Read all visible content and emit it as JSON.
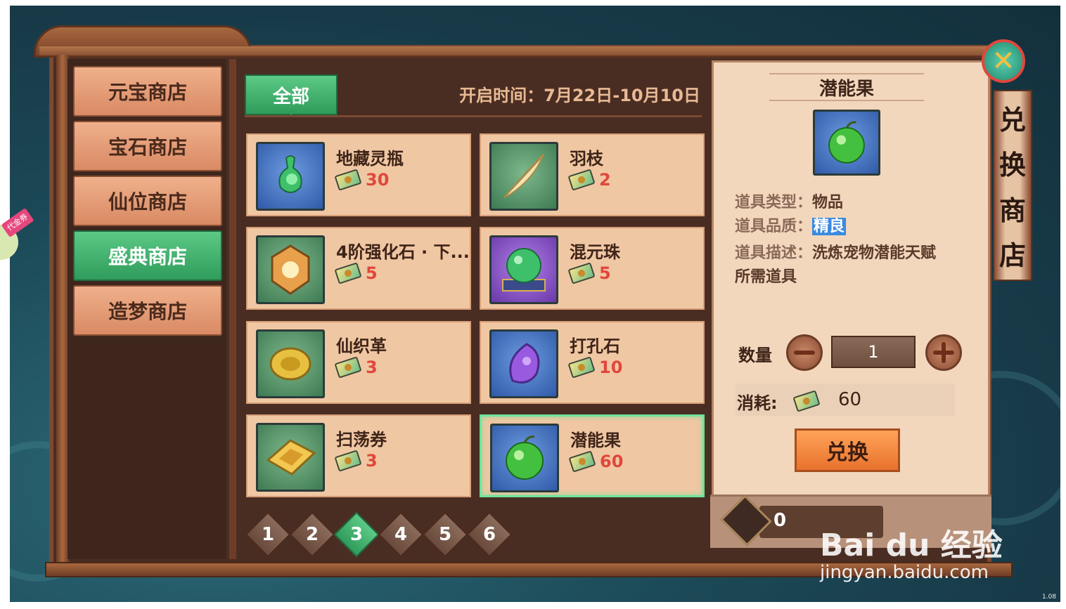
{
  "tabs": [
    {
      "label": "元宝商店",
      "active": false
    },
    {
      "label": "宝石商店",
      "active": false
    },
    {
      "label": "仙位商店",
      "active": false
    },
    {
      "label": "盛典商店",
      "active": true
    },
    {
      "label": "造梦商店",
      "active": false
    }
  ],
  "side_badge": {
    "label": "代金券"
  },
  "filter": {
    "label": "全部"
  },
  "open_time": "开启时间：7月22日-10月10日",
  "items": [
    {
      "name": "地藏灵瓶",
      "price": "30",
      "icon": "jade-vase-icon",
      "frame": "blue"
    },
    {
      "name": "羽枝",
      "price": "2",
      "icon": "feather-icon",
      "frame": "green"
    },
    {
      "name": "4阶强化石 · 下...",
      "price": "5",
      "icon": "amber-stone-icon",
      "frame": "green"
    },
    {
      "name": "混元珠",
      "price": "5",
      "icon": "green-orb-icon",
      "frame": "purple"
    },
    {
      "name": "仙织革",
      "price": "3",
      "icon": "golden-scroll-icon",
      "frame": "green"
    },
    {
      "name": "打孔石",
      "price": "10",
      "icon": "purple-stone-icon",
      "frame": "blue"
    },
    {
      "name": "扫荡券",
      "price": "3",
      "icon": "raid-ticket-icon",
      "frame": "green"
    },
    {
      "name": "潜能果",
      "price": "60",
      "icon": "green-fruit-icon",
      "frame": "blue",
      "selected": true
    }
  ],
  "pages": [
    "1",
    "2",
    "3",
    "4",
    "5",
    "6"
  ],
  "current_page": "3",
  "detail": {
    "title": "潜能果",
    "type_label": "道具类型：",
    "type_value": "物品",
    "quality_label": "道具品质：",
    "quality_value": "精良",
    "desc_label": "道具描述：",
    "desc_value": "洗炼宠物潜能天赋",
    "desc_line2": "所需道具",
    "qty_label": "数量",
    "qty_value": "1",
    "cost_label": "消耗:",
    "cost_value": "60",
    "exchange_label": "兑换",
    "balance": "0"
  },
  "banner": [
    "兑",
    "换",
    "商",
    "店"
  ],
  "close_glyph": "✕",
  "watermark": {
    "logo": "Bai du 经验",
    "url": "jingyan.baidu.com"
  },
  "version": "1.08"
}
